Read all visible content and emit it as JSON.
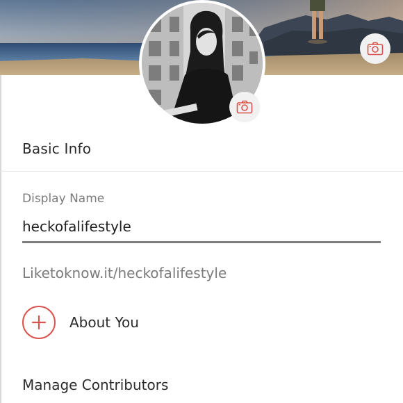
{
  "header": {
    "cover_camera_icon": "camera-icon",
    "avatar_camera_icon": "camera-icon"
  },
  "basic_info": {
    "title": "Basic Info"
  },
  "display_name": {
    "label": "Display Name",
    "value": "heckofalifestyle"
  },
  "profile_url": "Liketoknow.it/heckofalifestyle",
  "about": {
    "icon": "plus-icon",
    "label": "About You"
  },
  "contributors": {
    "title": "Manage Contributors"
  },
  "colors": {
    "accent": "#d9534f",
    "input_underline": "#7d7d7d",
    "muted_text": "#7b7b7b"
  }
}
